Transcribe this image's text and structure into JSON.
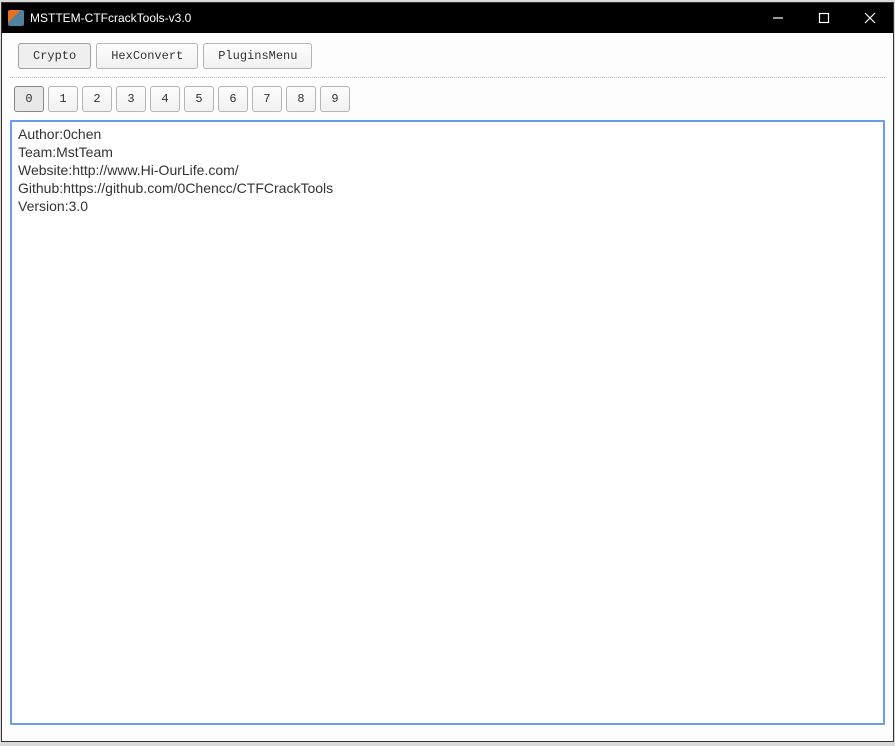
{
  "window": {
    "title": "MSTTEM-CTFcrackTools-v3.0"
  },
  "menubar": {
    "items": [
      {
        "label": "Crypto",
        "active": true
      },
      {
        "label": "HexConvert",
        "active": false
      },
      {
        "label": "PluginsMenu",
        "active": false
      }
    ]
  },
  "tabs": {
    "items": [
      {
        "label": "0",
        "active": true
      },
      {
        "label": "1",
        "active": false
      },
      {
        "label": "2",
        "active": false
      },
      {
        "label": "3",
        "active": false
      },
      {
        "label": "4",
        "active": false
      },
      {
        "label": "5",
        "active": false
      },
      {
        "label": "6",
        "active": false
      },
      {
        "label": "7",
        "active": false
      },
      {
        "label": "8",
        "active": false
      },
      {
        "label": "9",
        "active": false
      }
    ]
  },
  "editor": {
    "content": "Author:0chen\nTeam:MstTeam\nWebsite:http://www.Hi-OurLife.com/\nGithub:https://github.com/0Chencc/CTFCrackTools\nVersion:3.0"
  }
}
